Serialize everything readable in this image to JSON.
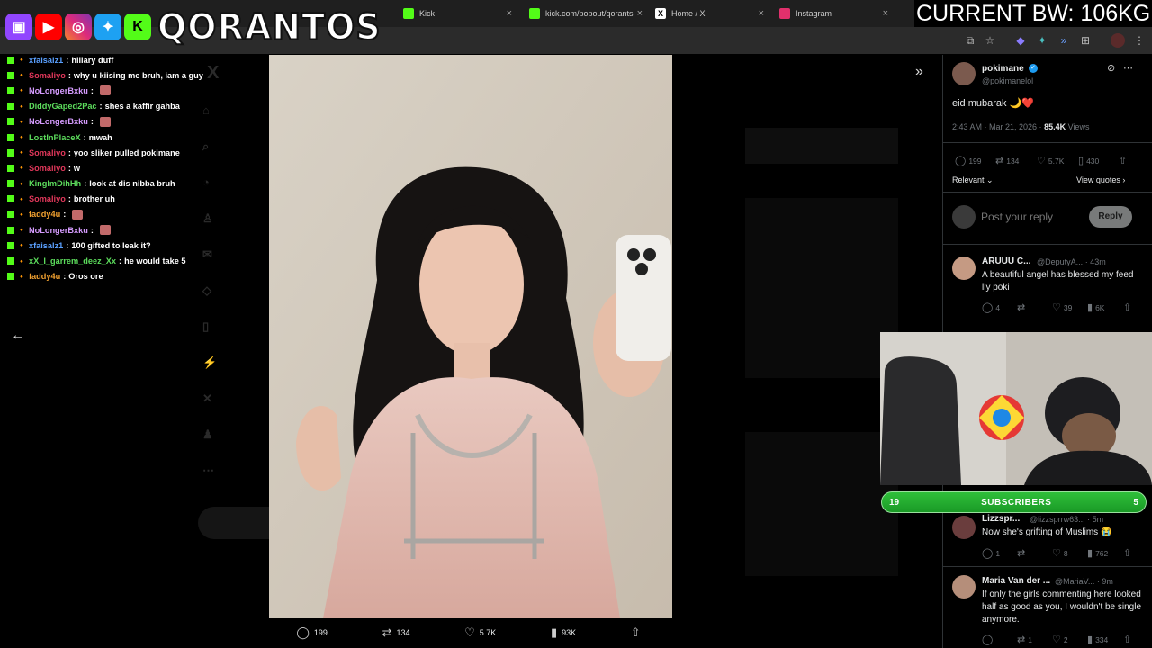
{
  "browser": {
    "tabs": [
      {
        "label": "Kick",
        "color": "#53fc18"
      },
      {
        "label": "kick.com/popout/qorants",
        "color": "#53fc18"
      },
      {
        "label": "Home / X",
        "color": "#000000"
      },
      {
        "label": "Instagram",
        "color": "#e1306c"
      }
    ]
  },
  "overlay": {
    "brand": "QORANTOS",
    "social_icons": [
      "twitch-icon",
      "youtube-icon",
      "instagram-icon",
      "twitter-icon",
      "kick-icon"
    ],
    "bw_text": "CURRENT BW: 106KG",
    "subscribers": {
      "left": "19",
      "label": "SUBSCRIBERS",
      "right": "5"
    }
  },
  "chat": [
    {
      "user": "xfaisalz1",
      "color": "#5aa0ff",
      "text": "hillary duff",
      "emote": false
    },
    {
      "user": "Somaliyo",
      "color": "#e0375a",
      "text": "why u kiising me bruh, iam a guy",
      "emote": false
    },
    {
      "user": "NoLongerBxku",
      "color": "#d69cff",
      "text": "",
      "emote": true
    },
    {
      "user": "DiddyGaped2Pac",
      "color": "#5cdc5c",
      "text": "shes a kaffir gahba",
      "emote": false
    },
    {
      "user": "NoLongerBxku",
      "color": "#d69cff",
      "text": "",
      "emote": true
    },
    {
      "user": "LostInPlaceX",
      "color": "#5cdc5c",
      "text": "mwah",
      "emote": false
    },
    {
      "user": "Somaliyo",
      "color": "#e0375a",
      "text": "yoo sliker pulled pokimane",
      "emote": false
    },
    {
      "user": "Somaliyo",
      "color": "#e0375a",
      "text": "w",
      "emote": false
    },
    {
      "user": "KingImDihHh",
      "color": "#5cdc5c",
      "text": "look at dis nibba bruh",
      "emote": false
    },
    {
      "user": "Somaliyo",
      "color": "#e0375a",
      "text": "brother uh",
      "emote": false
    },
    {
      "user": "faddy4u",
      "color": "#f0a030",
      "text": "",
      "emote": true
    },
    {
      "user": "NoLongerBxku",
      "color": "#d69cff",
      "text": "",
      "emote": true
    },
    {
      "user": "xfaisalz1",
      "color": "#5aa0ff",
      "text": "100 gifted to leak it?",
      "emote": false
    },
    {
      "user": "xX_I_garrem_deez_Xx",
      "color": "#5cdc5c",
      "text": "he would take 5",
      "emote": false
    },
    {
      "user": "faddy4u",
      "color": "#f0a030",
      "text": "Oros ore",
      "emote": false
    }
  ],
  "media_actions": [
    {
      "icon": "reply-icon",
      "glyph": "◯",
      "count": "199"
    },
    {
      "icon": "retweet-icon",
      "glyph": "⇄",
      "count": "134"
    },
    {
      "icon": "like-icon",
      "glyph": "♡",
      "count": "5.7K"
    },
    {
      "icon": "views-icon",
      "glyph": "▮",
      "count": "93K"
    },
    {
      "icon": "share-icon",
      "glyph": "⇧",
      "count": ""
    }
  ],
  "tweet": {
    "name": "pokimane",
    "handle": "@pokimanelol",
    "text": "eid mubarak 🌙❤️",
    "time": "2:43 AM · Mar 21, 2026 · ",
    "views": "85.4K",
    "views_label": " Views",
    "stats": {
      "replies": "199",
      "retweets": "134",
      "likes": "5.7K",
      "bookmarks": "430"
    },
    "relevant_label": "Relevant",
    "view_quotes_label": "View quotes",
    "reply_placeholder": "Post your reply",
    "reply_button": "Reply"
  },
  "replies": [
    {
      "name": "ARUUU C...",
      "handle": "@DeputyA...",
      "time": "· 43m",
      "text": "A beautiful angel has blessed my feed lly poki",
      "stats": [
        "4",
        "",
        "39",
        "6K"
      ]
    },
    {
      "name": "Lizzspr...",
      "handle": "@lizzsprrw63...",
      "time": "· 5m",
      "text": "Now she's grifting of Muslims 😭",
      "stats": [
        "1",
        "",
        "8",
        "762"
      ]
    },
    {
      "name": "Maria Van der ...",
      "handle": "@MariaV...",
      "time": "· 9m",
      "text": "If only the girls commenting here looked half as good as you, I wouldn't be single anymore.",
      "stats": [
        "",
        "1",
        "2",
        "334"
      ]
    }
  ]
}
